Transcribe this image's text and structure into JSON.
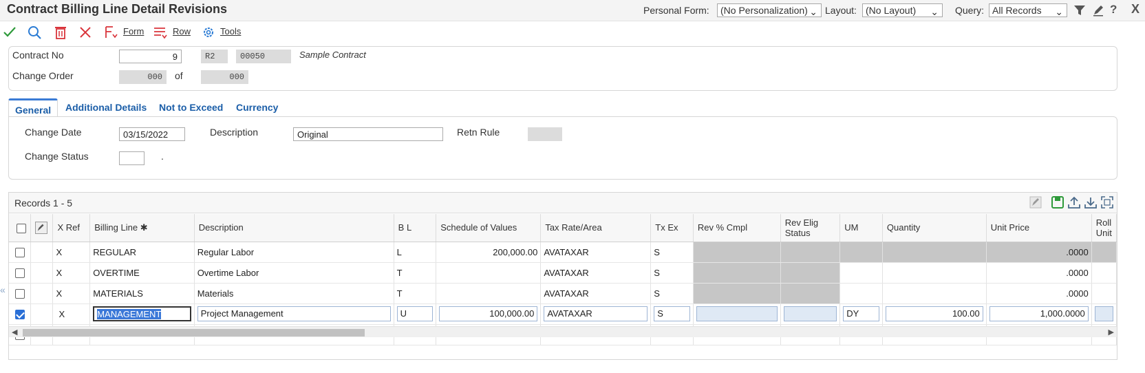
{
  "header": {
    "title": "Contract Billing Line Detail Revisions",
    "personal_form_label": "Personal Form:",
    "personal_form_value": "(No Personalization)",
    "layout_label": "Layout:",
    "layout_value": "(No Layout)",
    "query_label": "Query:",
    "query_value": "All Records",
    "close_label": "X"
  },
  "toolbar": {
    "form_label": "Form",
    "row_label": "Row",
    "tools_label": "Tools"
  },
  "contract": {
    "contract_no_label": "Contract No",
    "contract_no": "9",
    "doc_type": "R2",
    "company": "00050",
    "description": "Sample Contract",
    "change_order_label": "Change Order",
    "change_order": "000",
    "of_label": "of",
    "change_order_total": "000"
  },
  "tabs": [
    "General",
    "Additional Details",
    "Not to Exceed",
    "Currency"
  ],
  "general": {
    "change_date_label": "Change Date",
    "change_date": "03/15/2022",
    "description_label": "Description",
    "description": "Original",
    "retn_rule_label": "Retn Rule",
    "retn_rule": "",
    "change_status_label": "Change Status",
    "change_status": "",
    "change_status_desc": "."
  },
  "grid": {
    "records_label": "Records 1 - 5",
    "columns": {
      "xref": "X Ref",
      "billing_line": "Billing Line",
      "description": "Description",
      "bl": "B L",
      "sov": "Schedule of Values",
      "tax": "Tax Rate/Area",
      "txex": "Tx Ex",
      "rev_pct": "Rev % Cmpl",
      "rev_elig": "Rev Elig Status",
      "um": "UM",
      "quantity": "Quantity",
      "unit_price": "Unit Price",
      "rollup": "Roll Unit"
    },
    "rows": [
      {
        "checked": false,
        "xref": "X",
        "billing_line": "REGULAR",
        "description": "Regular Labor",
        "bl": "L",
        "sov": "200,000.00",
        "tax": "AVATAXAR",
        "txex": "S",
        "um": "",
        "quantity": "",
        "unit_price": ".0000"
      },
      {
        "checked": false,
        "xref": "X",
        "billing_line": "OVERTIME",
        "description": "Overtime Labor",
        "bl": "T",
        "sov": "",
        "tax": "AVATAXAR",
        "txex": "S",
        "um": "",
        "quantity": "",
        "unit_price": ".0000"
      },
      {
        "checked": false,
        "xref": "X",
        "billing_line": "MATERIALS",
        "description": "Materials",
        "bl": "T",
        "sov": "",
        "tax": "AVATAXAR",
        "txex": "S",
        "um": "",
        "quantity": "",
        "unit_price": ".0000"
      },
      {
        "checked": true,
        "xref": "X",
        "billing_line": "MANAGEMENT",
        "description": "Project Management",
        "bl": "U",
        "sov": "100,000.00",
        "tax": "AVATAXAR",
        "txex": "S",
        "um": "DY",
        "quantity": "100.00",
        "unit_price": "1,000.0000"
      },
      {
        "checked": false,
        "xref": "",
        "billing_line": "",
        "description": "",
        "bl": "",
        "sov": "",
        "tax": "",
        "txex": "",
        "um": "",
        "quantity": "",
        "unit_price": ""
      }
    ]
  },
  "colors": {
    "accent": "#1b5ea8",
    "check_green": "#2e9a3a",
    "delete_red": "#d9343b",
    "selection_blue": "#3b78d8"
  }
}
